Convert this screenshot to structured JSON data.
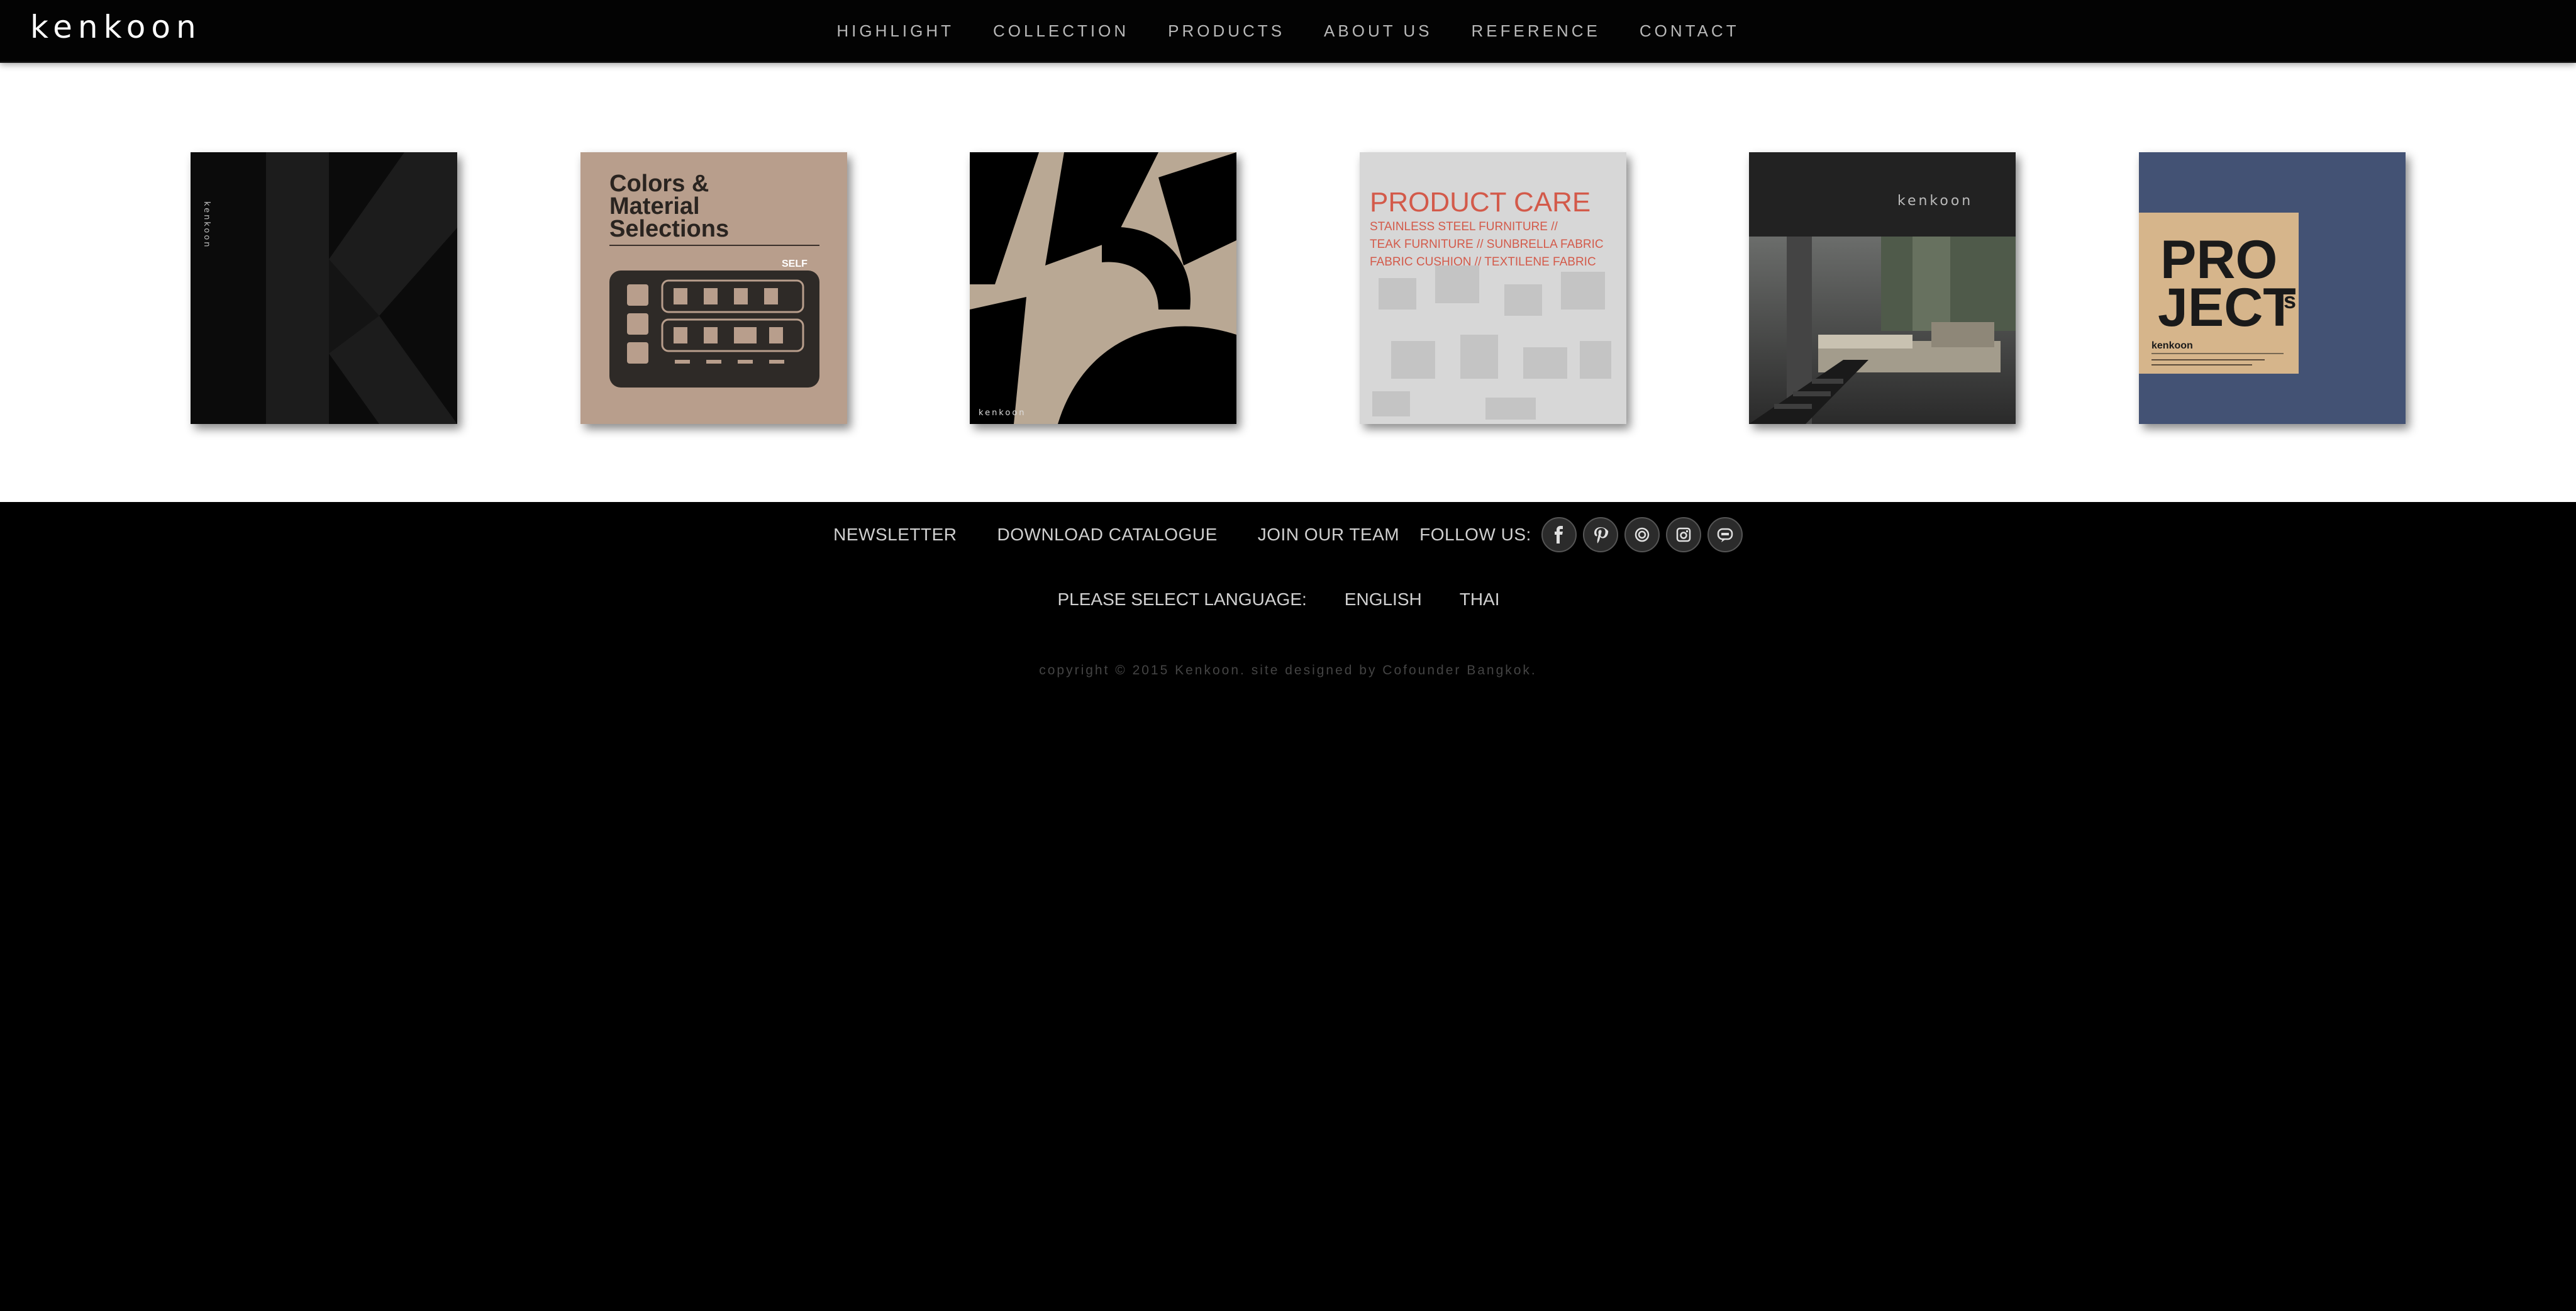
{
  "header": {
    "logo": "kenkoon",
    "nav": [
      "HIGHLIGHT",
      "COLLECTION",
      "PRODUCTS",
      "ABOUT US",
      "REFERENCE",
      "CONTACT"
    ]
  },
  "catalogs": {
    "cover1": {
      "vertical_text": "kenkoon",
      "color": "#0c0c0c"
    },
    "cover2": {
      "title_lines": [
        "Colors &",
        "Material",
        "Selections"
      ],
      "badge": "SELF",
      "color": "#b89e8c"
    },
    "cover3": {
      "brand": "kenkoon",
      "color": "#b9a894"
    },
    "cover4": {
      "title": "PRODUCT CARE",
      "subtitle_lines": [
        "STAINLESS STEEL FURNITURE //",
        "TEAK FURNITURE // SUNBRELLA FABRIC",
        "FABRIC CUSHION // TEXTILENE FABRIC"
      ],
      "color": "#d7d7d7",
      "accent": "#d35a4a"
    },
    "cover5": {
      "brand": "kenkoon",
      "color": "#222"
    },
    "cover6": {
      "title_line1": "PRO",
      "title_line2": "JECT",
      "title_suffix": "s",
      "brand": "kenkoon",
      "color": "#435274",
      "panel_color": "#d6b58b"
    }
  },
  "footer": {
    "links": [
      "NEWSLETTER",
      "DOWNLOAD CATALOGUE",
      "JOIN OUR TEAM"
    ],
    "follow_label": "FOLLOW US:",
    "social_icons": [
      "facebook-icon",
      "pinterest-icon",
      "instagram-icon",
      "camera-icon",
      "line-icon"
    ],
    "language_label": "PLEASE SELECT LANGUAGE:",
    "languages": [
      "ENGLISH",
      "THAI"
    ],
    "copyright": "copyright © 2015 Kenkoon. site designed by Cofounder Bangkok."
  }
}
